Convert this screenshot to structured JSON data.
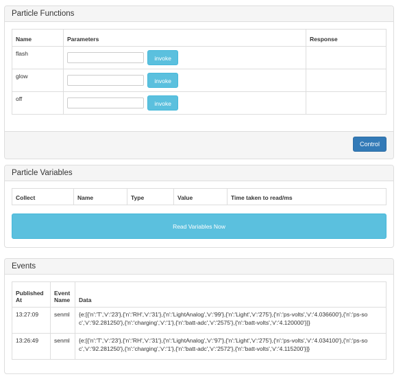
{
  "functions_panel": {
    "title": "Particle Functions",
    "headers": {
      "name": "Name",
      "parameters": "Parameters",
      "response": "Response"
    },
    "rows": [
      {
        "name": "flash",
        "param_value": "",
        "invoke_label": "invoke",
        "response": ""
      },
      {
        "name": "glow",
        "param_value": "",
        "invoke_label": "invoke",
        "response": ""
      },
      {
        "name": "off",
        "param_value": "",
        "invoke_label": "invoke",
        "response": ""
      }
    ],
    "footer_button_label": "Control"
  },
  "variables_panel": {
    "title": "Particle Variables",
    "headers": {
      "collect": "Collect",
      "name": "Name",
      "type": "Type",
      "value": "Value",
      "time": "Time taken to read/ms"
    },
    "read_button_label": "Read Variables Now"
  },
  "events_panel": {
    "title": "Events",
    "headers": {
      "published_at": "Published At",
      "event_name": "Event Name",
      "data": "Data"
    },
    "rows": [
      {
        "published_at": "13:27:09",
        "event_name": "senml",
        "data": "{e:[{'n':'T','v':'23'},{'n':'RH','v':'31'},{'n':'LightAnalog','v':'99'},{'n':'Light','v':'275'},{'n':'ps-volts','v':'4.036600'},{'n':'ps-soc','v':'92.281250'},{'n':'charging','v':'1'},{'n':'batt-adc','v':'2575'},{'n':'batt-volts','v':'4.120000'}]}"
      },
      {
        "published_at": "13:26:49",
        "event_name": "senml",
        "data": "{e:[{'n':'T','v':'23'},{'n':'RH','v':'31'},{'n':'LightAnalog','v':'97'},{'n':'Light','v':'275'},{'n':'ps-volts','v':'4.034100'},{'n':'ps-soc','v':'92.281250'},{'n':'charging','v':'1'},{'n':'batt-adc','v':'2572'},{'n':'batt-volts','v':'4.115200'}]}"
      }
    ]
  }
}
